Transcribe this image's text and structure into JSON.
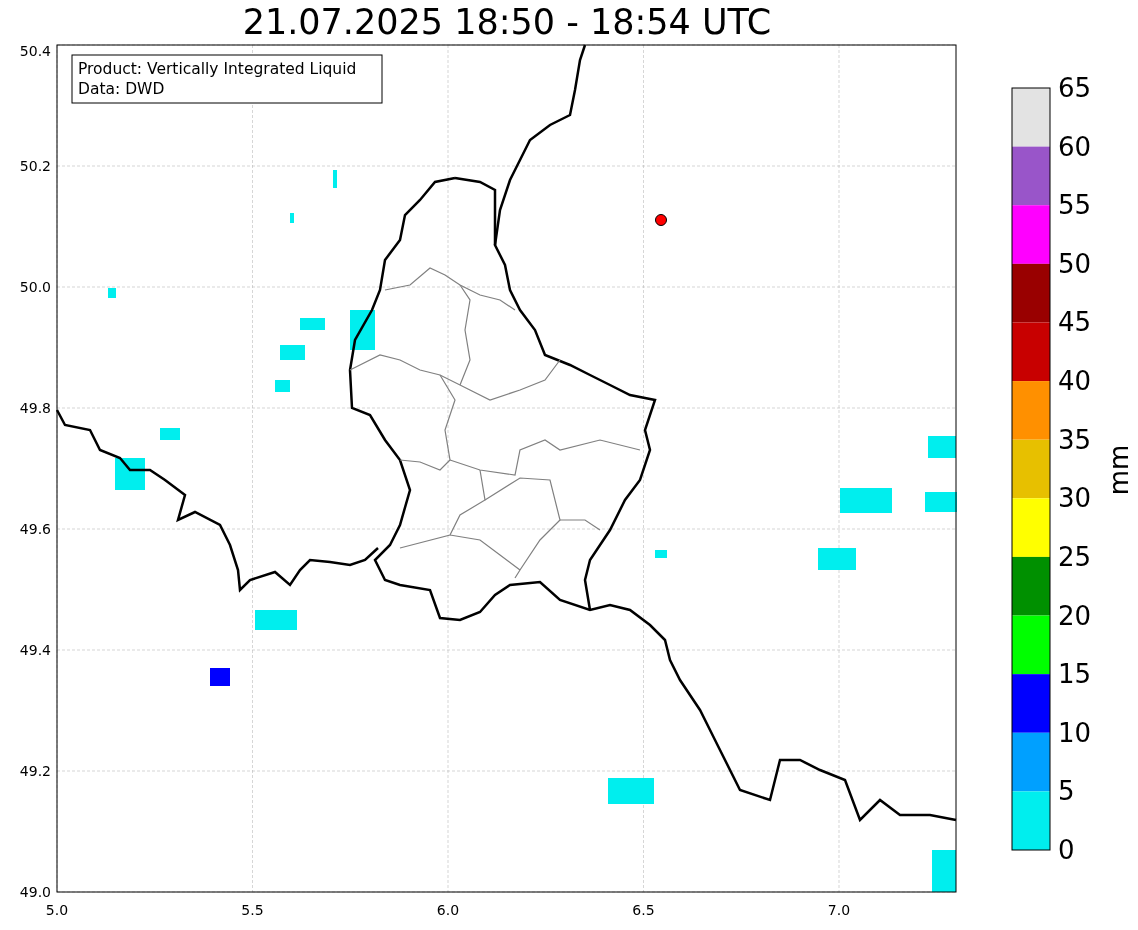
{
  "title": "21.07.2025 18:50 - 18:54 UTC",
  "info_box": [
    "Product: Vertically Integrated Liquid",
    "Data: DWD"
  ],
  "x_axis": {
    "ticks": [
      "5.0",
      "5.5",
      "6.0",
      "6.5",
      "7.0"
    ]
  },
  "y_axis": {
    "ticks": [
      "50.4",
      "50.2",
      "50.0",
      "49.8",
      "49.6",
      "49.4",
      "49.2",
      "49.0"
    ]
  },
  "colorbar": {
    "label": "mm",
    "ticks": [
      "65",
      "60",
      "55",
      "50",
      "45",
      "40",
      "35",
      "30",
      "25",
      "20",
      "15",
      "10",
      "5",
      "0"
    ],
    "bins": [
      {
        "color": "#e3e3e3"
      },
      {
        "color": "#9955c9"
      },
      {
        "color": "#ff00ff"
      },
      {
        "color": "#990000"
      },
      {
        "color": "#c80000"
      },
      {
        "color": "#ff9000"
      },
      {
        "color": "#e7c000"
      },
      {
        "color": "#ffff00"
      },
      {
        "color": "#009000"
      },
      {
        "color": "#00ff00"
      },
      {
        "color": "#0000ff"
      },
      {
        "color": "#00a0ff"
      },
      {
        "color": "#00eeee"
      }
    ]
  }
}
